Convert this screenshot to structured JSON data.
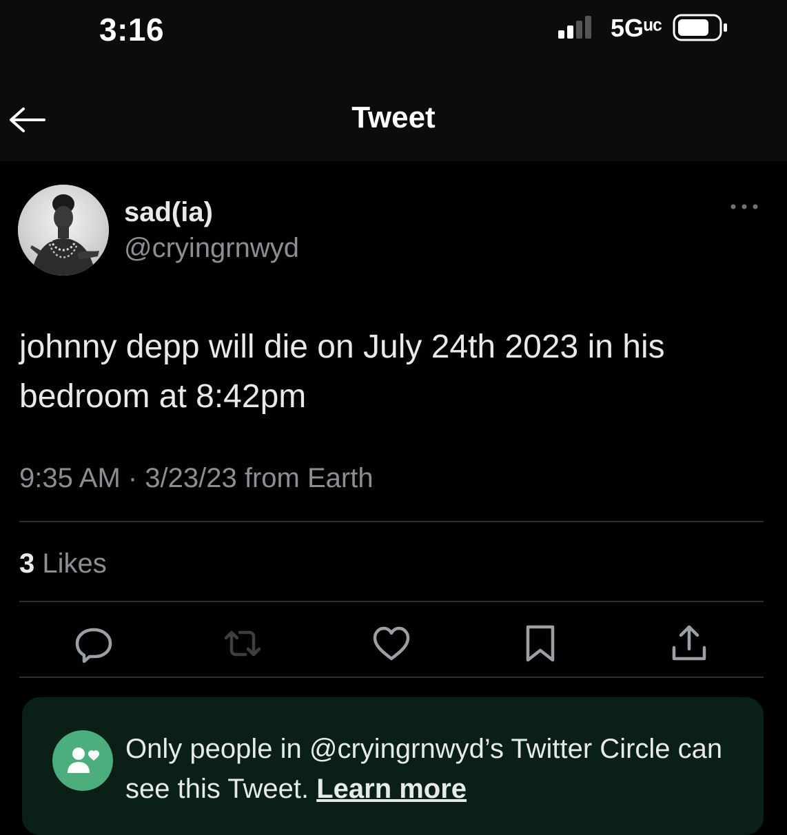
{
  "status_bar": {
    "time": "3:16",
    "network": "5Gᵘᶜ",
    "icons": [
      "signal-icon",
      "battery-icon"
    ]
  },
  "header": {
    "title": "Tweet",
    "back_icon": "back-arrow-icon"
  },
  "tweet": {
    "display_name": "sad(ia)",
    "handle": "@cryingrnwyd",
    "text": "johnny depp will die on July 24th 2023 in his bedroom at 8:42pm",
    "meta": "9:35 AM · 3/23/23 from Earth",
    "likes_count": "3",
    "likes_label": " Likes",
    "more_icon": "more-options-icon"
  },
  "actions": [
    {
      "name": "reply-icon"
    },
    {
      "name": "retweet-icon"
    },
    {
      "name": "like-icon"
    },
    {
      "name": "bookmark-icon"
    },
    {
      "name": "share-icon"
    }
  ],
  "circle_notice": {
    "text": "Only people in @cryingrnwyd’s Twitter Circle can see this Tweet.",
    "link": "Learn more",
    "icon": "twitter-circle-icon"
  },
  "colors": {
    "background": "#000000",
    "bar_background": "#0c0c0c",
    "secondary_text": "#8b8f93",
    "circle_background": "#0a1f15",
    "circle_accent": "#4cae7c"
  }
}
